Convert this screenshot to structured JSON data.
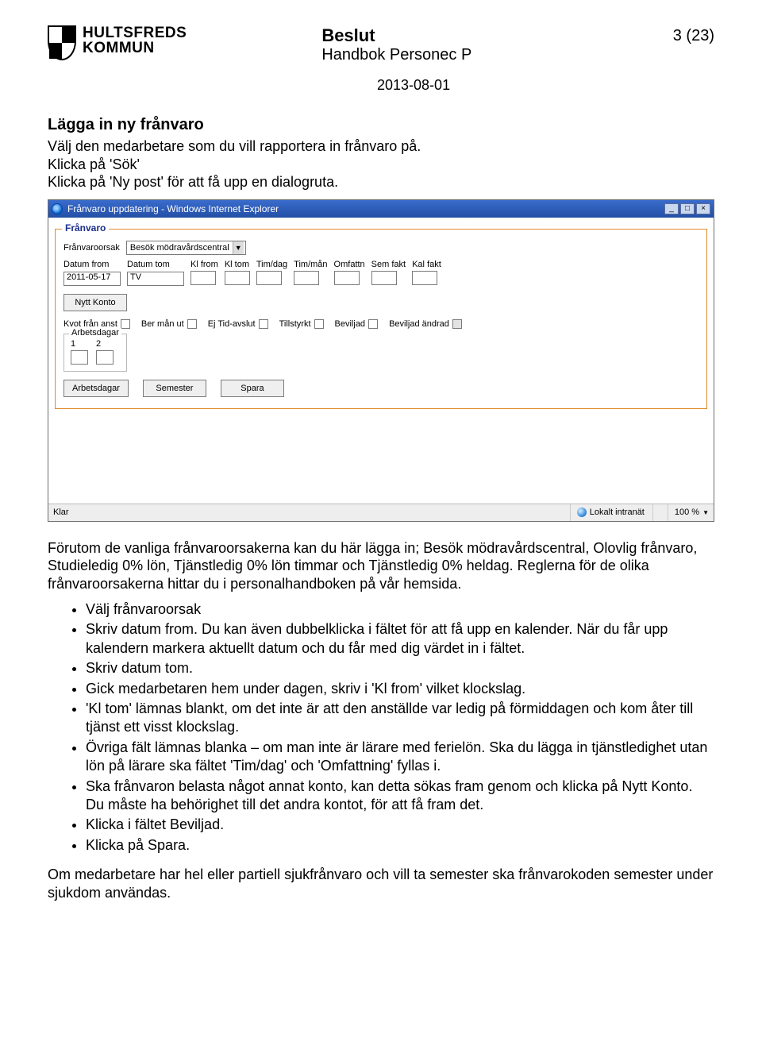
{
  "header": {
    "org_line1": "HULTSFREDS",
    "org_line2": "KOMMUN",
    "title": "Beslut",
    "subtitle": "Handbok Personec P",
    "date": "2013-08-01",
    "page_label": "3 (23)"
  },
  "section": {
    "heading": "Lägga in ny frånvaro",
    "intro1": "Välj den medarbetare som du vill rapportera in frånvaro på.",
    "intro2": "Klicka på 'Sök'",
    "intro3": "Klicka på 'Ny post' för att få upp en dialogruta."
  },
  "window": {
    "title": "Frånvaro uppdatering - Windows Internet Explorer",
    "btn_min": "_",
    "btn_max": "□",
    "btn_close": "×",
    "group_legend": "Frånvaro",
    "reason_label": "Frånvaroorsak",
    "reason_value": "Besök mödravårdscentral",
    "cols": {
      "datum_from": "Datum from",
      "datum_tom": "Datum tom",
      "kl_from": "Kl from",
      "kl_tom": "Kl tom",
      "tim_dag": "Tim/dag",
      "tim_man": "Tim/mån",
      "omfattn": "Omfattn",
      "sem_fakt": "Sem fakt",
      "kal_fakt": "Kal fakt"
    },
    "vals": {
      "datum_from": "2011-05-17",
      "datum_tom": "TV"
    },
    "nytt_konto_btn": "Nytt Konto",
    "checks": {
      "kvot": "Kvot från anst",
      "ber": "Ber mån ut",
      "ej": "Ej Tid-avslut",
      "till": "Tillstyrkt",
      "bev": "Beviljad",
      "bev_andr": "Beviljad ändrad"
    },
    "arbetsdagar_legend": "Arbetsdagar",
    "n1": "1",
    "n2": "2",
    "buttons": {
      "arbetsdagar": "Arbetsdagar",
      "semester": "Semester",
      "spara": "Spara"
    },
    "status_left": "Klar",
    "status_zone": "Lokalt intranät",
    "status_zoom": "100 %"
  },
  "para1": "Förutom de vanliga frånvaroorsakerna kan du här lägga in; Besök mödravårdscentral, Olovlig frånvaro, Studieledig 0% lön, Tjänstledig 0% lön timmar och Tjänstledig 0% heldag. Reglerna för de olika frånvaroorsakerna hittar du i personalhandboken på vår hemsida.",
  "bullets": [
    "Välj frånvaroorsak",
    "Skriv datum from. Du kan även dubbelklicka i fältet för att få upp en kalender. När du får upp kalendern markera aktuellt datum och du får med dig värdet in i fältet.",
    "Skriv datum tom.",
    "Gick medarbetaren hem under dagen, skriv i 'Kl from' vilket klockslag.",
    "'Kl tom' lämnas blankt, om det inte är att den anställde var ledig på förmiddagen och kom åter till tjänst ett visst klockslag.",
    "Övriga fält lämnas blanka – om man inte är lärare med ferielön. Ska du lägga in tjänstledighet utan lön på lärare ska fältet 'Tim/dag' och 'Omfattning' fyllas i.",
    "Ska frånvaron belasta något annat konto, kan detta sökas fram genom och klicka på Nytt Konto. Du måste ha behörighet till det andra kontot, för att få fram det.",
    "Klicka i fältet Beviljad.",
    "Klicka på Spara."
  ],
  "para2": "Om medarbetare har hel eller partiell sjukfrånvaro och vill ta semester ska frånvarokoden semester under sjukdom användas."
}
